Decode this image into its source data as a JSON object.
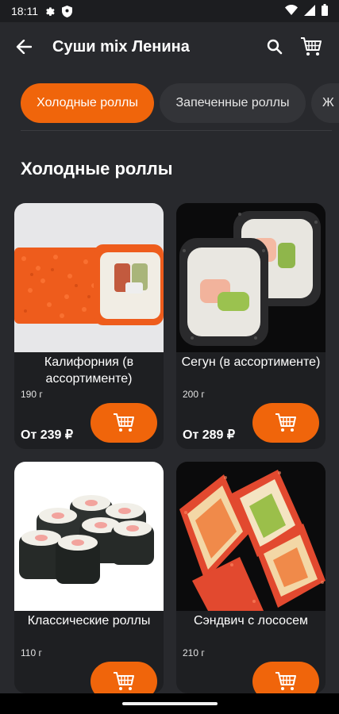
{
  "status_bar": {
    "time": "18:11",
    "icons": [
      "gear-icon",
      "shield-icon",
      "wifi-icon",
      "signal-icon",
      "battery-icon"
    ]
  },
  "app_bar": {
    "title": "Суши mix Ленина",
    "icons": [
      "back-arrow-icon",
      "search-icon",
      "cart-icon"
    ]
  },
  "categories": [
    {
      "label": "Холодные роллы",
      "active": true
    },
    {
      "label": "Запеченные роллы",
      "active": false
    },
    {
      "label": "Ж",
      "active": false
    }
  ],
  "section": {
    "title": "Холодные роллы"
  },
  "products": [
    {
      "name": "Калифорния (в ассортименте)",
      "weight": "190 г",
      "price": "От 239 ₽"
    },
    {
      "name": "Сегун (в ассортименте)",
      "weight": "200 г",
      "price": "От 289 ₽"
    },
    {
      "name": "Классические роллы",
      "weight": "110 г",
      "price": ""
    },
    {
      "name": "Сэндвич с лососем",
      "weight": "210 г",
      "price": ""
    }
  ],
  "colors": {
    "accent": "#f0650b",
    "background": "#28292d",
    "card": "#1e1f22",
    "chip_inactive": "#333438"
  }
}
